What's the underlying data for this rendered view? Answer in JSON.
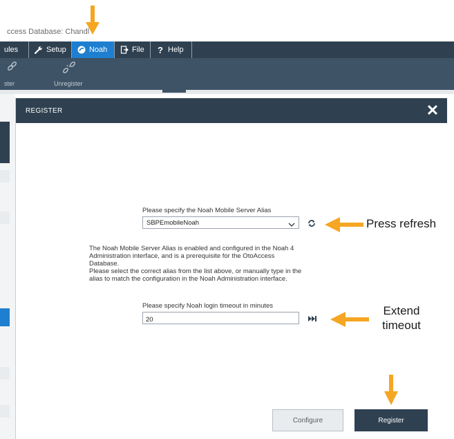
{
  "app": {
    "title": "ccess Database: Chandl"
  },
  "menubar": {
    "items": [
      {
        "label": "ules",
        "icon": "none"
      },
      {
        "label": "Setup",
        "icon": "wrench-icon"
      },
      {
        "label": "Noah",
        "icon": "noah-icon"
      },
      {
        "label": "File",
        "icon": "file-icon"
      },
      {
        "label": "Help",
        "icon": "question-icon"
      }
    ],
    "active": "Noah"
  },
  "ribbon": {
    "buttons": [
      {
        "label": "ster",
        "icon": "link-icon"
      },
      {
        "label": "Unregister",
        "icon": "broken-link-icon"
      }
    ]
  },
  "dialog": {
    "title": "REGISTER",
    "alias_label": "Please specify the Noah Mobile Server Alias",
    "alias_value": "SBPEmobileNoah",
    "info_lines": [
      "The Noah Mobile Server Alias is enabled and configured in the Noah 4",
      "Administration interface, and is a prerequisite for the OtoAccess",
      "Database.",
      "Please select the correct alias from the list above, or manually type in the",
      "alias to match the configuration in the Noah Administration interface."
    ],
    "timeout_label": "Please specify Noah login timeout in minutes",
    "timeout_value": "20",
    "configure_label": "Configure",
    "register_label": "Register"
  },
  "annotations": {
    "refresh": "Press refresh",
    "timeout_line1": "Extend",
    "timeout_line2": "timeout",
    "arrow_color": "#f5a623"
  },
  "colors": {
    "menubar_bg": "#2f4151",
    "active_tab": "#1e7fd0",
    "dialog_header": "#2f4151",
    "register_button": "#2f4151"
  }
}
